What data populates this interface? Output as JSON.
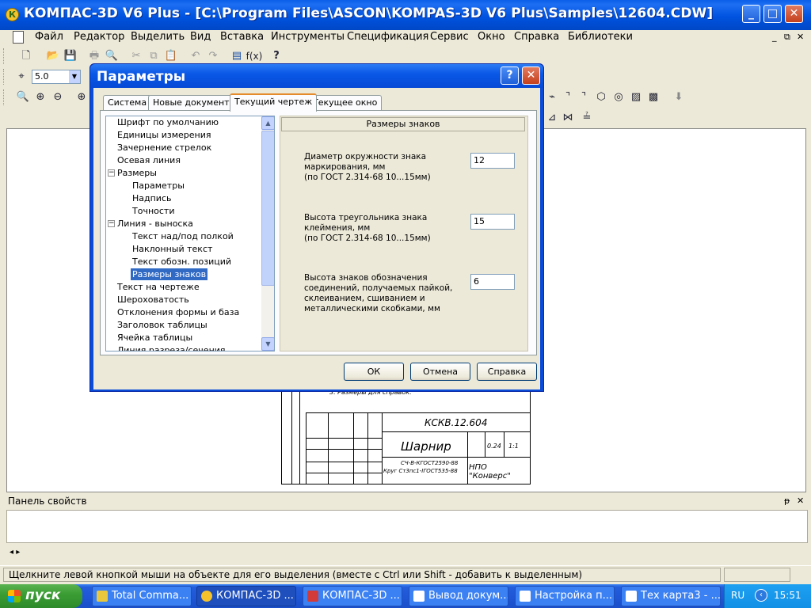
{
  "window": {
    "title": "КОМПАС-3D V6 Plus - [C:\\Program Files\\ASCON\\KOMPAS-3D V6 Plus\\Samples\\12604.CDW]",
    "logo": "К",
    "controls": {
      "minimize": "_",
      "maximize": "□",
      "close": "✕"
    }
  },
  "menubar": {
    "items": [
      "Файл",
      "Редактор",
      "Выделить",
      "Вид",
      "Вставка",
      "Инструменты",
      "Спецификация",
      "Сервис",
      "Окно",
      "Справка",
      "Библиотеки"
    ],
    "mdi_controls": {
      "minimize": "_",
      "restore": "⧉",
      "close": "✕"
    }
  },
  "toolbar": {
    "scale_value": "5.0",
    "fx_label": "f(x)",
    "help_label": "?"
  },
  "dialog": {
    "title": "Параметры",
    "help_btn": "?",
    "close_btn": "✕",
    "tabs": [
      "Система",
      "Новые документы",
      "Текущий чертеж",
      "Текущее окно"
    ],
    "active_tab": "Текущий чертеж",
    "tree": [
      {
        "label": "Шрифт по умолчанию",
        "level": 0
      },
      {
        "label": "Единицы измерения",
        "level": 0
      },
      {
        "label": "Зачернение стрелок",
        "level": 0
      },
      {
        "label": "Осевая линия",
        "level": 0
      },
      {
        "label": "Размеры",
        "level": 0,
        "expander": "−"
      },
      {
        "label": "Параметры",
        "level": 1
      },
      {
        "label": "Надпись",
        "level": 1
      },
      {
        "label": "Точности",
        "level": 1
      },
      {
        "label": "Линия - выноска",
        "level": 0,
        "expander": "−"
      },
      {
        "label": "Текст над/под полкой",
        "level": 1
      },
      {
        "label": "Наклонный текст",
        "level": 1
      },
      {
        "label": "Текст обозн. позиций",
        "level": 1
      },
      {
        "label": "Размеры знаков",
        "level": 1,
        "selected": true
      },
      {
        "label": "Текст на чертеже",
        "level": 0
      },
      {
        "label": "Шероховатость",
        "level": 0
      },
      {
        "label": "Отклонения формы и база",
        "level": 0
      },
      {
        "label": "Заголовок таблицы",
        "level": 0
      },
      {
        "label": "Ячейка таблицы",
        "level": 0
      },
      {
        "label": "Линия разреза/сечения",
        "level": 0
      }
    ],
    "group_title": "Размеры знаков",
    "params": [
      {
        "label": "Диаметр окружности знака маркирования, мм",
        "note": "(по ГОСТ 2.314-68 10...15мм)",
        "value": "12"
      },
      {
        "label": "Высота треугольника знака клеймения, мм",
        "note": "(по ГОСТ 2.314-68 10...15мм)",
        "value": "15"
      },
      {
        "label": "Высота знаков обозначения соединений, получаемых пайкой, склеиванием, сшиванием и металлическими скобками, мм",
        "note": "",
        "value": "6"
      }
    ],
    "buttons": {
      "ok": "ОК",
      "cancel": "Отмена",
      "help": "Справка"
    }
  },
  "drawing": {
    "note": "3. Размеры для справок.",
    "code": "КСКВ.12.604",
    "name": "Шарнир",
    "mass": "0.24",
    "scale": "1:1",
    "material_1": "СЧ-В-КГОСТ2590-88",
    "material_2": "Круг Ст3пс1-IГОСТ535-88",
    "org": "НПО \"Конверс\""
  },
  "properties_panel": {
    "title": "Панель свойств",
    "pin": "ᵽ",
    "close": "✕",
    "nav": "◂ ▸"
  },
  "statusbar": {
    "text": "Щелкните левой кнопкой мыши на объекте для его выделения (вместе с Ctrl или Shift - добавить к выделенным)"
  },
  "taskbar": {
    "start_label": "пуск",
    "tasks": [
      {
        "label": "Total Comma...",
        "color": "#e8c73c"
      },
      {
        "label": "КОМПАС-3D ...",
        "color": "#f4c22b",
        "active": true
      },
      {
        "label": "КОМПАС-3D ...",
        "color": "#d23a3a"
      },
      {
        "label": "Вывод докум...",
        "color": "#ffffff"
      },
      {
        "label": "Настройка п...",
        "color": "#2a55c4"
      },
      {
        "label": "Тех карта3 - ...",
        "color": "#2a55c4"
      }
    ],
    "lang": "RU",
    "clock": "15:51"
  }
}
